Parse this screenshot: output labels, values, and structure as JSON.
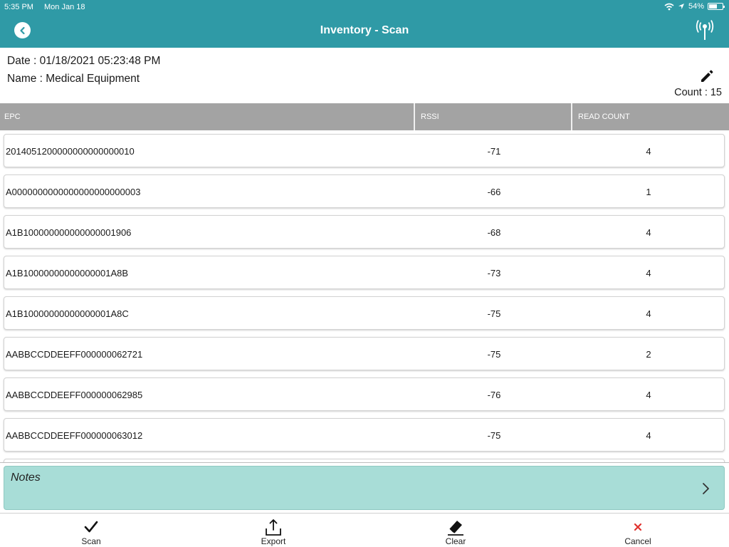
{
  "status_bar": {
    "time": "5:35 PM",
    "date": "Mon Jan 18",
    "battery": "54%",
    "icons": [
      "wifi-icon",
      "location-icon",
      "battery-icon"
    ]
  },
  "nav": {
    "title": "Inventory - Scan",
    "back_icon": "back-arrow-icon",
    "antenna_icon": "rfid-antenna-icon"
  },
  "info": {
    "date_label": "Date : 01/18/2021 05:23:48 PM",
    "name_label": "Name : Medical Equipment",
    "edit_icon": "pencil-icon",
    "count_label": "Count :",
    "count_value": "15"
  },
  "table": {
    "headers": {
      "epc": "EPC",
      "rssi": "RSSI",
      "read_count": "READ COUNT"
    },
    "rows": [
      {
        "epc": "2014051200000000000000010",
        "rssi": "-71",
        "read_count": "4"
      },
      {
        "epc": "A0000000000000000000000003",
        "rssi": "-66",
        "read_count": "1"
      },
      {
        "epc": "A1B100000000000000001906",
        "rssi": "-68",
        "read_count": "4"
      },
      {
        "epc": "A1B10000000000000001A8B",
        "rssi": "-73",
        "read_count": "4"
      },
      {
        "epc": "A1B10000000000000001A8C",
        "rssi": "-75",
        "read_count": "4"
      },
      {
        "epc": "AABBCCDDEEFF000000062721",
        "rssi": "-75",
        "read_count": "2"
      },
      {
        "epc": "AABBCCDDEEFF000000062985",
        "rssi": "-76",
        "read_count": "4"
      },
      {
        "epc": "AABBCCDDEEFF000000063012",
        "rssi": "-75",
        "read_count": "4"
      }
    ]
  },
  "notes": {
    "label": "Notes",
    "chevron_icon": "chevron-right-icon"
  },
  "toolbar": {
    "scan": "Scan",
    "export": "Export",
    "clear": "Clear",
    "cancel": "Cancel"
  },
  "colors": {
    "header": "#2f9aa6",
    "table_header": "#a3a3a3",
    "notes": "#a8ddd7",
    "cancel": "#e0322e"
  }
}
